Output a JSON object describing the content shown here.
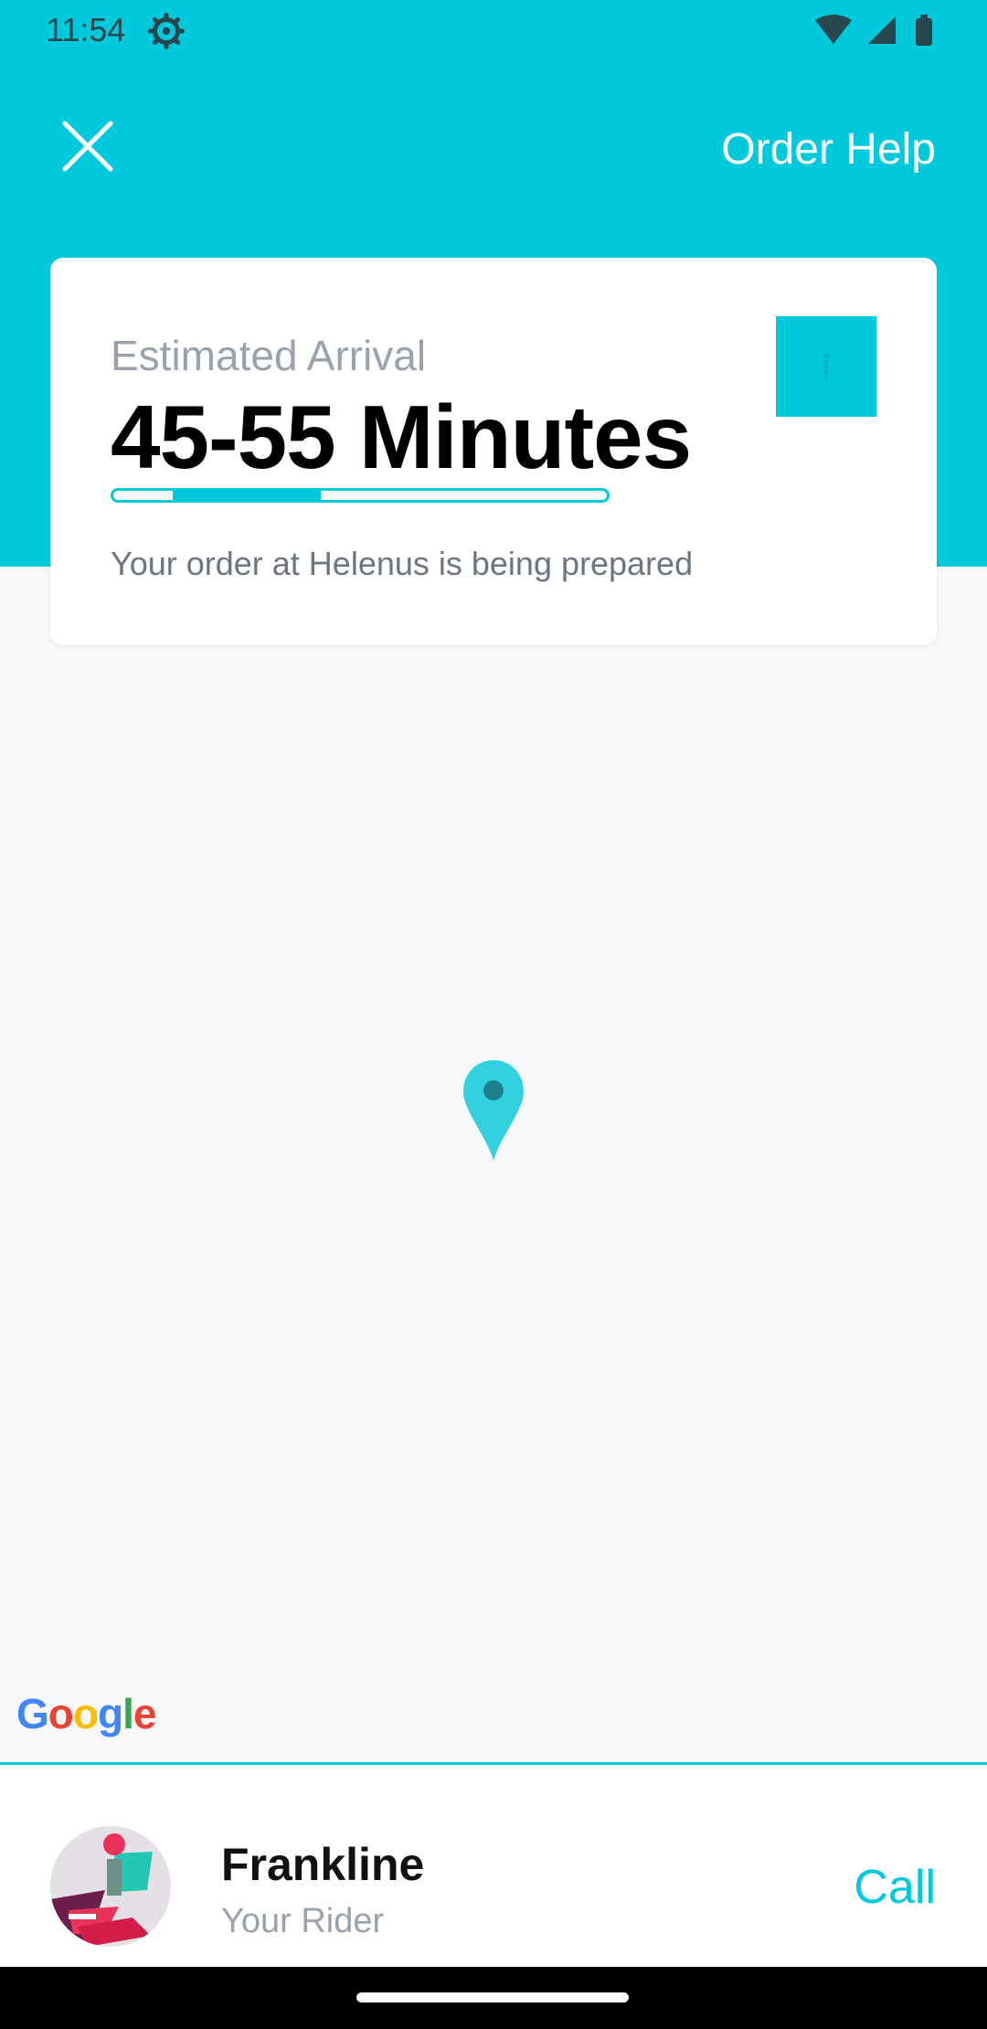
{
  "status_bar": {
    "time": "11:54",
    "icons": [
      "settings-gear-icon",
      "wifi-icon",
      "signal-icon",
      "battery-icon"
    ]
  },
  "header": {
    "close_icon": "close-icon",
    "order_help_label": "Order Help",
    "background_color": "#00c9dc"
  },
  "eta_card": {
    "label": "Estimated Arrival",
    "value": "45-55 Minutes",
    "progress": {
      "start_fraction": 0.12,
      "end_fraction": 0.42
    },
    "message": "Your order at Helenus is being prepared",
    "accent_color": "#00c9dc"
  },
  "map": {
    "pin_icon": "map-pin-icon",
    "attribution": "Google"
  },
  "rider": {
    "name": "Frankline",
    "role": "Your Rider",
    "call_label": "Call"
  }
}
